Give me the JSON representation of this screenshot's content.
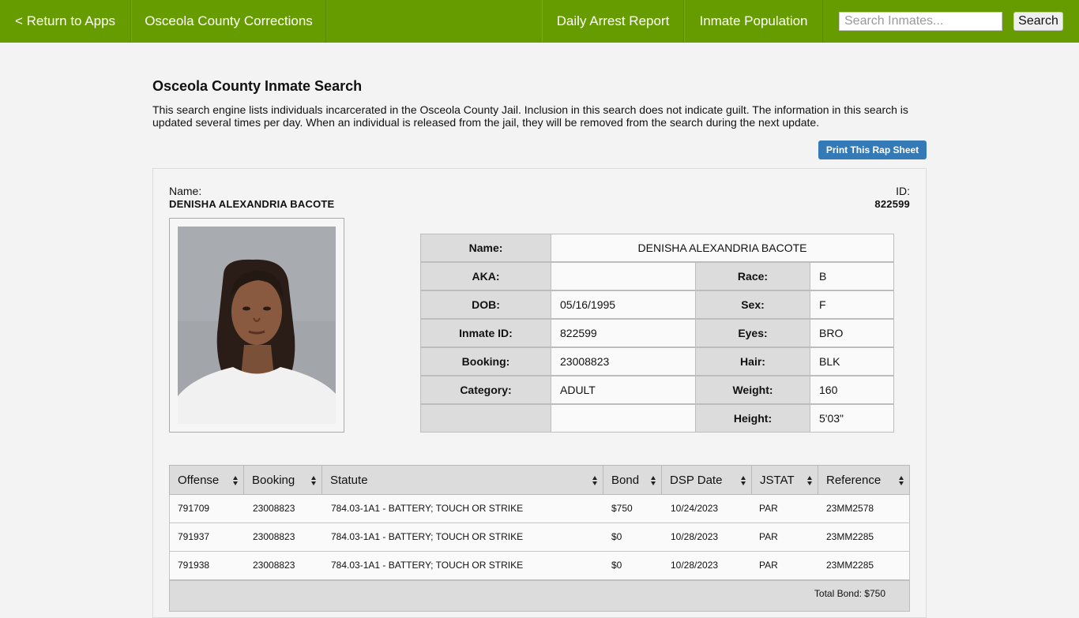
{
  "nav": {
    "back_label": "< Return to Apps",
    "site_label": "Osceola County Corrections",
    "daily_arrest": "Daily Arrest Report",
    "population": "Inmate Population",
    "search_placeholder": "Search Inmates...",
    "search_button": "Search"
  },
  "page": {
    "title": "Osceola County Inmate Search",
    "intro": "This search engine lists individuals incarcerated in the Osceola County Jail. Inclusion in this search does not indicate guilt. The information in this search is updated several times per day. When an individual is released from the jail, they will be removed from the search during the next update.",
    "print_button": "Print This Rap Sheet"
  },
  "inmate": {
    "name_label": "Name:",
    "name": "DENISHA ALEXANDRIA BACOTE",
    "id_label": "ID:",
    "id": "822599"
  },
  "details": {
    "name_label": "Name:",
    "name_value": "DENISHA ALEXANDRIA BACOTE",
    "aka_label": "AKA:",
    "aka_value": "",
    "race_label": "Race:",
    "race_value": "B",
    "dob_label": "DOB:",
    "dob_value": "05/16/1995",
    "sex_label": "Sex:",
    "sex_value": "F",
    "inmate_id_label": "Inmate ID:",
    "inmate_id_value": "822599",
    "eyes_label": "Eyes:",
    "eyes_value": "BRO",
    "booking_label": "Booking:",
    "booking_value": "23008823",
    "hair_label": "Hair:",
    "hair_value": "BLK",
    "category_label": "Category:",
    "category_value": "ADULT",
    "weight_label": "Weight:",
    "weight_value": "160",
    "height_label": "Height:",
    "height_value": "5'03\""
  },
  "charges": {
    "headers": [
      "Offense",
      "Booking",
      "Statute",
      "Bond",
      "DSP Date",
      "JSTAT",
      "Reference"
    ],
    "rows": [
      [
        "791709",
        "23008823",
        "784.03-1A1 - BATTERY; TOUCH OR STRIKE",
        "$750",
        "10/24/2023",
        "PAR",
        "23MM2578"
      ],
      [
        "791937",
        "23008823",
        "784.03-1A1 - BATTERY; TOUCH OR STRIKE",
        "$0",
        "10/28/2023",
        "PAR",
        "23MM2285"
      ],
      [
        "791938",
        "23008823",
        "784.03-1A1 - BATTERY; TOUCH OR STRIKE",
        "$0",
        "10/28/2023",
        "PAR",
        "23MM2285"
      ]
    ],
    "total_bond": "Total Bond: $750"
  }
}
